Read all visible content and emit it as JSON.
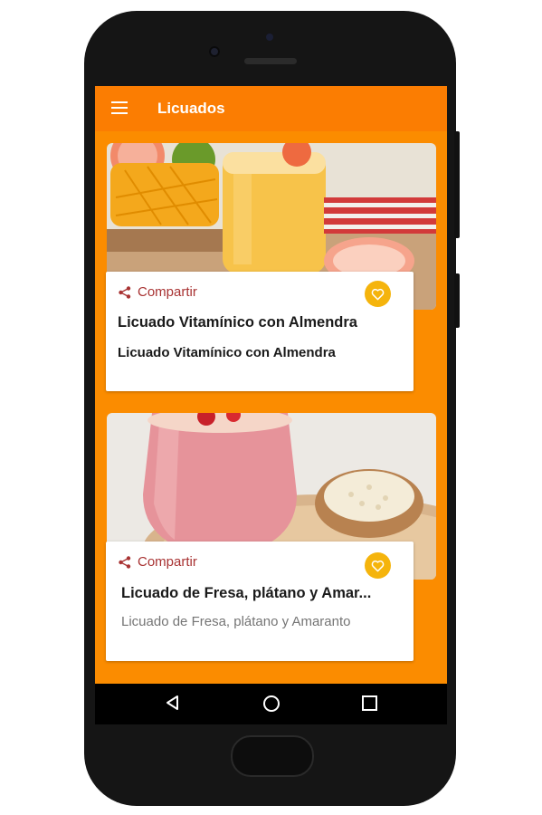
{
  "app": {
    "title": "Licuados",
    "menu_icon": "menu-icon",
    "colors": {
      "appbar": "#fb7d02",
      "background": "#fb8c00",
      "favorite": "#f5b40c",
      "share": "#a83232"
    }
  },
  "recipes": [
    {
      "share_label": "Compartir",
      "share_icon": "share-icon",
      "favorite_icon": "heart-icon",
      "title": "Licuado Vitamínico con Almendra",
      "subtitle": "Licuado Vitamínico con Almendra"
    },
    {
      "share_label": "Compartir",
      "share_icon": "share-icon",
      "favorite_icon": "heart-icon",
      "title": "Licuado de Fresa, plátano y Amar...",
      "subtitle": "Licuado de Fresa, plátano y Amaranto"
    }
  ],
  "navigation": [
    "back-icon",
    "home-icon",
    "recents-icon"
  ]
}
